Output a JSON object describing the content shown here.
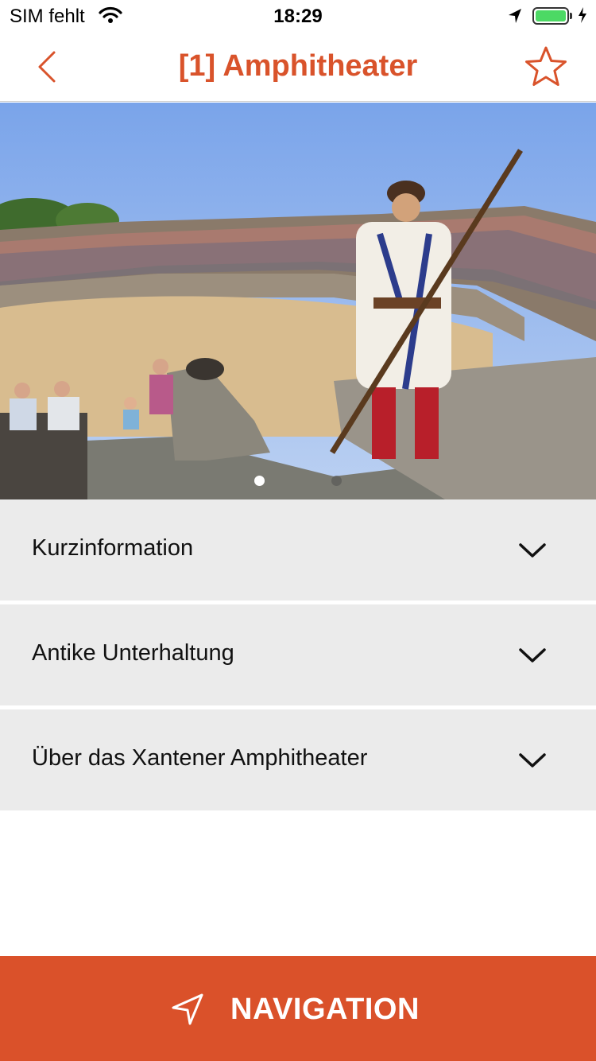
{
  "status": {
    "carrier": "SIM fehlt",
    "time": "18:29",
    "battery_color": "#4cd964"
  },
  "nav": {
    "title": "[1] Amphitheater",
    "back_icon": "chevron-left-icon",
    "favorite_icon": "star-outline-icon",
    "accent_color": "#d9532b"
  },
  "hero": {
    "image_description": "Amphitheater arena with spectators and a Roman-costumed man holding a spear",
    "pager": {
      "count": 2,
      "active_index": 0
    }
  },
  "sections": [
    {
      "label": "Kurzinformation",
      "expanded": false
    },
    {
      "label": "Antike Unterhaltung",
      "expanded": false
    },
    {
      "label": "Über das Xantener Amphitheater",
      "expanded": false
    }
  ],
  "footer": {
    "button_label": "NAVIGATION",
    "icon": "navigation-arrow-icon",
    "background": "#da512a"
  }
}
